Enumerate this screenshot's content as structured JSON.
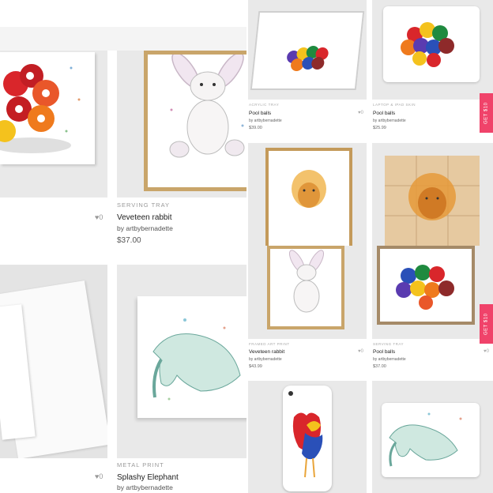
{
  "left_panel": {
    "products": [
      {
        "category": "",
        "title": "",
        "artist": "",
        "price": "",
        "likes": ""
      },
      {
        "category": "SERVING TRAY",
        "title": "Veveteen rabbit",
        "artist": "by artbybernadette",
        "price": "$37.00",
        "likes": "0"
      },
      {
        "category": "",
        "title": "",
        "artist": "",
        "price": "",
        "likes": "0"
      },
      {
        "category": "METAL PRINT",
        "title": "Splashy Elephant",
        "artist": "by artbybernadette",
        "price": "",
        "likes": ""
      }
    ],
    "heart_icon": "heart-icon"
  },
  "right_panel": {
    "products": [
      {
        "category": "ACRYLIC TRAY",
        "title": "Pool balls",
        "artist": "by artbybernadette",
        "price": "$39.00",
        "likes": "0"
      },
      {
        "category": "LAPTOP & IPAD SKIN",
        "title": "Pool balls",
        "artist": "by artbybernadette",
        "price": "$25.99",
        "likes": "0"
      },
      {
        "category": "FRAMED ART PRINT",
        "title": "Veveteen rabbit",
        "artist": "by artbybernadette",
        "price": "$43.99",
        "likes": "0"
      },
      {
        "category": "SERVING TRAY",
        "title": "Pool balls",
        "artist": "by artbybernadette",
        "price": "$37.00",
        "likes": "0"
      }
    ],
    "promo_label": "GET $10"
  },
  "colors": {
    "promo": "#f0436a",
    "tile_bg": "#e9e9e9",
    "frame_wood": "#c9a56a"
  }
}
